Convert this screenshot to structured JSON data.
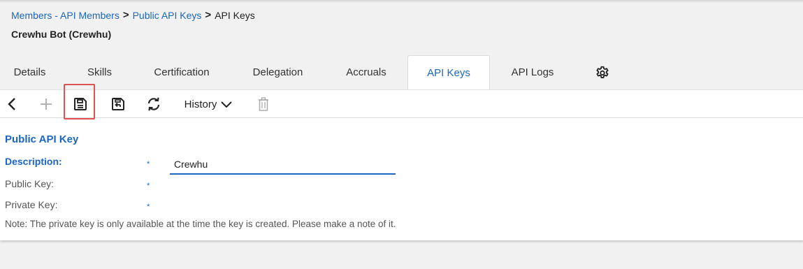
{
  "breadcrumb": {
    "items": [
      "Members - API Members",
      "Public API Keys"
    ],
    "current": "API Keys",
    "separator": ">"
  },
  "record_title": "Crewhu Bot (Crewhu)",
  "tabs": [
    {
      "label": "Details"
    },
    {
      "label": "Skills"
    },
    {
      "label": "Certification"
    },
    {
      "label": "Delegation"
    },
    {
      "label": "Accruals"
    },
    {
      "label": "API Keys",
      "active": true
    },
    {
      "label": "API Logs"
    }
  ],
  "settings_icon": "gear-icon",
  "toolbar": {
    "icons": [
      "back-arrow-icon",
      "add-icon",
      "save-icon",
      "save-and-close-icon",
      "refresh-icon",
      "chevron-down-icon",
      "trash-icon"
    ],
    "history_label": "History"
  },
  "form": {
    "section_title": "Public API Key",
    "fields": [
      {
        "label": "Description:",
        "value": "Crewhu",
        "required": "*"
      },
      {
        "label": "Public Key:",
        "value": "",
        "required": "*"
      },
      {
        "label": "Private Key:",
        "value": "",
        "required": "*"
      }
    ],
    "note": "Note: The private key is only available at the time the key is created. Please make a note of it."
  },
  "colors": {
    "accent": "#1a66c2",
    "highlight": "#e05252",
    "background": "#f1f1f1"
  }
}
